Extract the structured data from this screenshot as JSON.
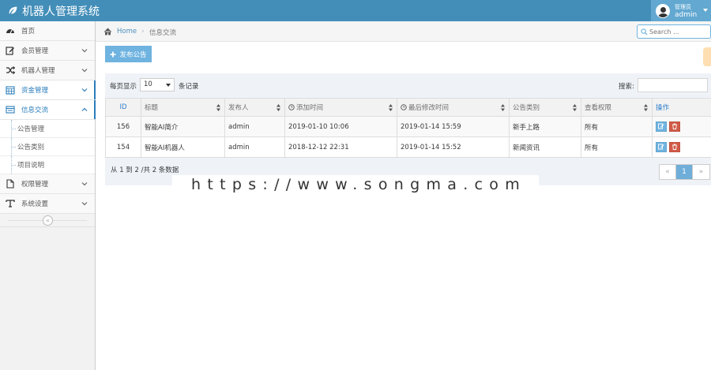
{
  "app": {
    "title": "机器人管理系统"
  },
  "user": {
    "role": "管理员",
    "name": "admin"
  },
  "breadcrumb": {
    "home": "Home",
    "current": "信息交流"
  },
  "search": {
    "placeholder": "Search ..."
  },
  "sidebar": {
    "items": [
      {
        "label": "首页",
        "icon": "dashboard-icon"
      },
      {
        "label": "会员管理",
        "icon": "edit-icon"
      },
      {
        "label": "机器人管理",
        "icon": "shuffle-icon"
      },
      {
        "label": "资金管理",
        "icon": "calendar-icon"
      },
      {
        "label": "信息交流",
        "icon": "list-icon"
      },
      {
        "label": "权限管理",
        "icon": "file-icon"
      },
      {
        "label": "系统设置",
        "icon": "text-icon"
      }
    ],
    "subitems": [
      "公告管理",
      "公告类别",
      "项目说明"
    ],
    "collapse_icon": "«"
  },
  "toolbar": {
    "publish_label": "发布公告"
  },
  "table": {
    "length_label": "每页显示",
    "length_value": "10",
    "length_suffix": "条记录",
    "filter_label": "搜索:",
    "columns": [
      "ID",
      "标题",
      "发布人",
      "添加时间",
      "最后修改时间",
      "公告类别",
      "查看权限",
      "操作"
    ],
    "rows": [
      {
        "id": "156",
        "title": "智能AI简介",
        "author": "admin",
        "added": "2019-01-10 10:06",
        "modified": "2019-01-14 15:59",
        "category": "新手上路",
        "permission": "所有"
      },
      {
        "id": "154",
        "title": "智能AI机器人",
        "author": "admin",
        "added": "2018-12-12 22:31",
        "modified": "2019-01-14 15:52",
        "category": "新闻资讯",
        "permission": "所有"
      }
    ],
    "info": "从 1 到 2 /共 2 条数据",
    "pager": {
      "prev": "«",
      "current": "1",
      "next": "»"
    }
  },
  "watermark": "https://www.songma.com",
  "colors": {
    "navbar": "#438eb9",
    "accent": "#6fb3e0",
    "danger": "#d15b47"
  }
}
